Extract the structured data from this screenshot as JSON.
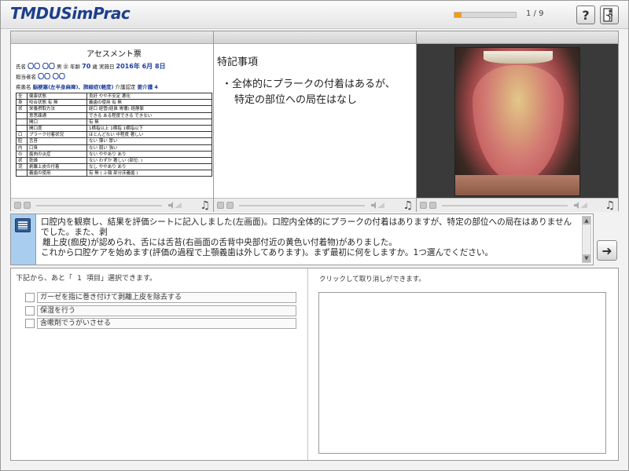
{
  "app": {
    "logo_text": "TMDUSimPrac",
    "progress_text": "1 / 9",
    "progress": {
      "current": 1,
      "total": 9
    },
    "help_label": "?",
    "exit_icon": "exit-door-icon",
    "colors": {
      "progress_fill": "#f39c12",
      "logo": "#1d3f8a",
      "message_icon_bg": "#a9cdef"
    }
  },
  "assessment": {
    "title": "アセスメント票",
    "line1": "氏名",
    "line1_name": "〇〇 〇〇",
    "line1_rest": "男 ㊛  年齢",
    "line1_age": "70",
    "line1_age_unit": "歳  実施日",
    "line1_date": "2016年 6月 8日",
    "line2": "担当者名",
    "line2_name": "〇〇 〇〇",
    "line3": "疾患名",
    "line3_value": "脳梗塞(左半身麻痺)、肺線症(軽度)",
    "line3_rest": "介護認定",
    "line3_care": "要介護 4",
    "rows": [
      [
        "全",
        "健康状態",
        "良好  やや不安定  悪化"
      ],
      [
        "身",
        "咬合状態   有   無",
        "義歯の使用   有  無"
      ],
      [
        "状",
        "栄養摂取方法",
        "経口  経管(経鼻 胃瘻)  経静脈"
      ],
      [
        "",
        "意思疎通",
        "できる  ある程度できる  できない"
      ],
      [
        "",
        "開口",
        "有  無"
      ],
      [
        "",
        "開口度",
        "1横指以上  1横指  1横指以下"
      ],
      [
        "口",
        "プラーク付着状況",
        "ほとんどない  中程度  著しい"
      ],
      [
        "腔",
        "舌苔",
        "ない  薄い  厚い"
      ],
      [
        "内",
        "口臭",
        "ない  弱い  強い"
      ],
      [
        "の",
        "歯肉の炎症",
        "ない  ややあり  あり"
      ],
      [
        "状",
        "乾燥",
        "ない  わずか  著しい (部位:         )"
      ],
      [
        "況",
        "剥離上皮の付着",
        "なし  ややあり  あり"
      ],
      [
        "",
        "義歯の使用",
        "有  無  ( 上顎  部分床義歯 )"
      ]
    ]
  },
  "notes": {
    "title": "特記事項",
    "bullet_line1": "・全体的にプラークの付着はあるが、",
    "bullet_line2": "特定の部位への局在はなし"
  },
  "message": {
    "line1": "口腔内を観察し、結果を評価シートに記入しました(左画面)。口腔内全体的にプラークの付着はありますが、特定の部位への局在はありませんでした。また、剥",
    "line2": "離上皮(痂皮)が認められ、舌には舌苔(右画面の舌背中央部付近の黄色い付着物)がありました。",
    "line3": "これから口腔ケアを始めます(評価の過程で上顎義歯は外してあります)。まず最初に何をしますか。1つ選んでください。",
    "next_icon": "arrow-right-icon"
  },
  "choices": {
    "prefix": "下記から、あと「",
    "count": "1",
    "suffix": "項目」選択できます。",
    "options": [
      {
        "label": "ガーゼを指に巻き付けて剥離上皮を除去する"
      },
      {
        "label": "保湿を行う"
      },
      {
        "label": "含嗽剤でうがいさせる"
      }
    ]
  },
  "selected": {
    "hint": "クリックして取り消しができます。"
  }
}
